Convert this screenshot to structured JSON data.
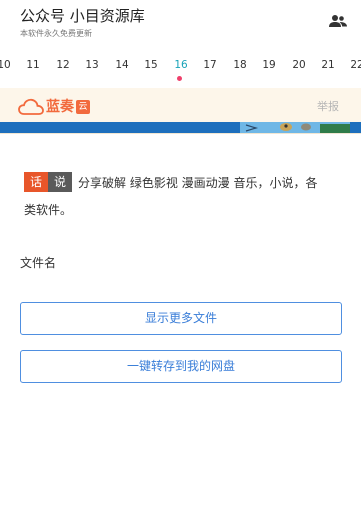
{
  "header": {
    "title": "公众号 小目资源库",
    "subtitle": "本软件永久免费更新",
    "icon": "people-icon"
  },
  "datebar": {
    "dates": [
      "10",
      "11",
      "12",
      "13",
      "14",
      "15",
      "16",
      "17",
      "18",
      "19",
      "20",
      "21",
      "22"
    ],
    "active_date": "16",
    "active_color": "#1aa3b8",
    "dot_color": "#ef3f6b"
  },
  "banner": {
    "logo_text": "蓝奏",
    "logo_badge": "云",
    "report_label": "举报",
    "brand_color": "#f26a3d"
  },
  "content": {
    "tag_1": "话",
    "tag_2": "说",
    "description_line1": "分享破解 绿色影视 漫画动漫 音乐，小说，各",
    "description_line2": "类软件。",
    "filename_label": "文件名"
  },
  "actions": {
    "show_more_label": "显示更多文件",
    "save_to_disk_label": "一键转存到我的网盘",
    "button_color": "#3a7ed8"
  }
}
